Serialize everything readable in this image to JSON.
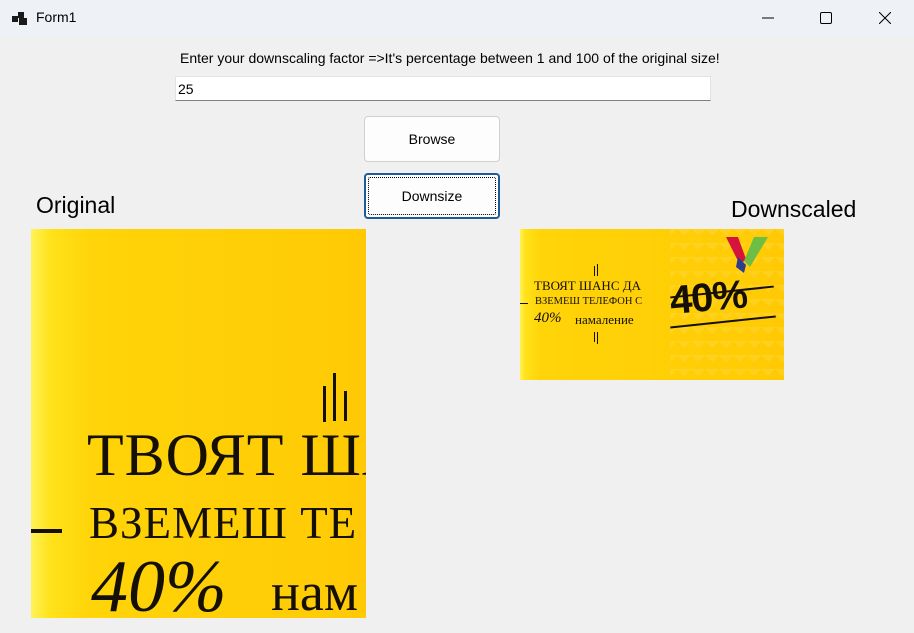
{
  "window": {
    "title": "Form1",
    "app_icon": "winforms-app-icon",
    "controls": [
      "minimize-icon",
      "maximize-icon",
      "close-icon"
    ]
  },
  "form": {
    "prompt": "Enter your downscaling factor =>It's percentage between 1 and 100 of the original size!",
    "factor_value": "25",
    "browse_label": "Browse",
    "downsize_label": "Downsize",
    "original_label": "Original",
    "downscaled_label": "Downscaled"
  },
  "original_image": {
    "line1": "ТВОЯТ ША",
    "line2": "ВЗЕМЕШ ТЕ",
    "line3_pct": "40%",
    "line3_word": "нам"
  },
  "downscaled_image": {
    "line1": "ТВОЯТ ШАНС ДА",
    "line2": "ВЗЕМЕШ ТЕЛЕФОН С",
    "line3_pct": "40%",
    "line3_word": "намаление",
    "big_pct": "40%",
    "colors": {
      "background": "#ffcc05",
      "logo_red": "#d4143c",
      "logo_green": "#6dbe45",
      "logo_blue": "#2a3d8f"
    }
  }
}
